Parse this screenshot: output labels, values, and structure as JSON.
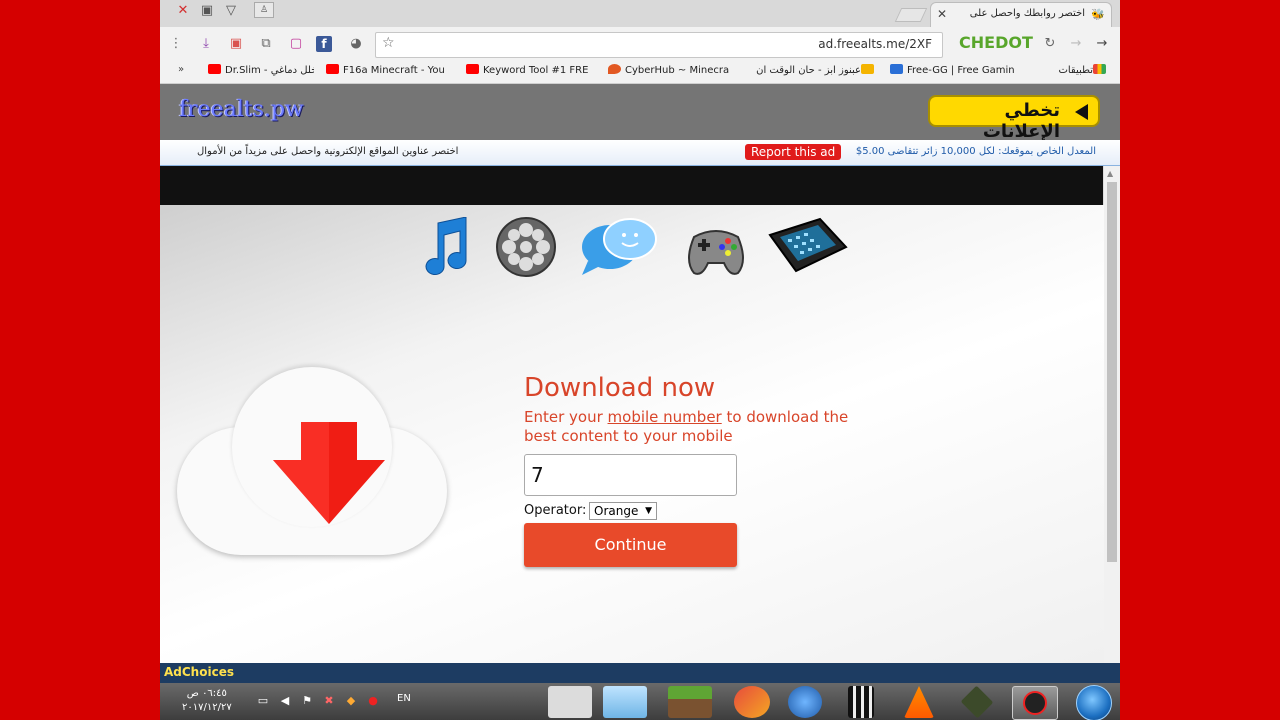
{
  "browser": {
    "tab_title": "اختصر روابطك واحصل على",
    "url": "ad.freealts.me/2XF",
    "brand": "CHEDOT"
  },
  "bookmarks": [
    {
      "label": "تطبيقات",
      "color": "#4285f4"
    },
    {
      "label": "Free-GG | Free Gamin",
      "color": "#2a6fd6"
    },
    {
      "label": "عبنوز ابز - حان الوقت ان",
      "color": "#f4b400"
    },
    {
      "label": "CyberHub ~ Minecra",
      "color": "#e25822"
    },
    {
      "label": "Keyword Tool #1 FRE",
      "color": "#ff0000"
    },
    {
      "label": "F16a Minecraft - You",
      "color": "#ff0000"
    },
    {
      "label": "Dr.Slim - خلل دماغي -",
      "color": "#ff0000"
    }
  ],
  "site": {
    "logo": "freealts.pw",
    "skip_ads": "تخطي الإعلانات",
    "info_right": "المعدل الخاص بموقعك: لكل 10,000 زائر تتقاضى 5.00$",
    "report": "Report this ad",
    "info_left": "اختصر عناوين المواقع الإلكترونية واحصل على مزيداً من الأموال"
  },
  "download": {
    "title": "Download now",
    "sub_before": "Enter your ",
    "sub_link": "mobile number",
    "sub_after": " to download the best content to your mobile",
    "phone_value": "7",
    "operator_label": "Operator:",
    "operator_selected": "Orange",
    "continue": "Continue"
  },
  "adchoices": "AdChoices",
  "taskbar": {
    "time": "٠٦:٤٥ ص",
    "date": "٢٠١٧/١٢/٢٧",
    "lang": "EN"
  },
  "colors": {
    "accent_red": "#e84a2a",
    "background_red": "#d50000",
    "brand_green": "#58a62b"
  },
  "icons": [
    "music-note-icon",
    "film-reel-icon",
    "chat-bubble-icon",
    "gamepad-icon",
    "phone-keypad-icon"
  ]
}
